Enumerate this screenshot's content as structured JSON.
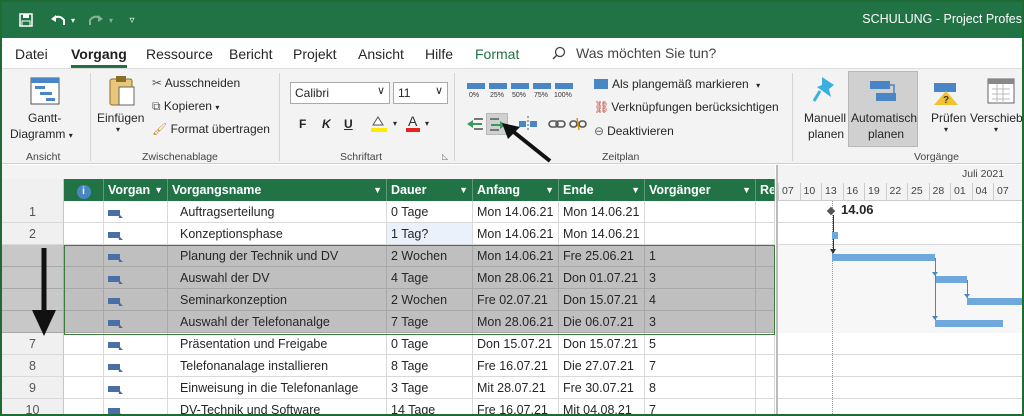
{
  "title_bar": {
    "title": "SCHULUNG  -  Project Profes"
  },
  "tabs": [
    "Datei",
    "Vorgang",
    "Ressource",
    "Bericht",
    "Projekt",
    "Ansicht",
    "Hilfe",
    "Format"
  ],
  "tell_me": "Was möchten Sie tun?",
  "ribbon": {
    "ansicht": {
      "label": "Ansicht",
      "gantt_line1": "Gantt-",
      "gantt_line2": "Diagramm"
    },
    "zwischenablage": {
      "label": "Zwischenablage",
      "paste": "Einfügen",
      "cut": "Ausschneiden",
      "copy": "Kopieren",
      "format_painter": "Format übertragen"
    },
    "schriftart": {
      "label": "Schriftart",
      "font": "Calibri",
      "size": "11",
      "bold": "F",
      "italic": "K",
      "underline": "U"
    },
    "zeitplan": {
      "label": "Zeitplan",
      "pct": [
        "0%",
        "25%",
        "50%",
        "75%",
        "100%"
      ],
      "mark_on_track": "Als plangemäß markieren",
      "respect_links": "Verknüpfungen berücksichtigen",
      "deactivate": "Deaktivieren"
    },
    "vorgaenge": {
      "label": "Vorgänge",
      "manual_1": "Manuell",
      "manual_2": "planen",
      "auto_1": "Automatisch",
      "auto_2": "planen",
      "inspect": "Prüfen",
      "move": "Verschieb"
    }
  },
  "table": {
    "columns": [
      "Vorgan",
      "Vorgangsname",
      "Dauer",
      "Anfang",
      "Ende",
      "Vorgänger",
      "Re"
    ],
    "rows": [
      {
        "num": "1",
        "name": "Auftragserteilung",
        "dauer": "0 Tage",
        "anfang": "Mon 14.06.21",
        "ende": "Mon 14.06.21",
        "vorg": ""
      },
      {
        "num": "2",
        "name": "Konzeptionsphase",
        "dauer": "1 Tag?",
        "anfang": "Mon 14.06.21",
        "ende": "Mon 14.06.21",
        "vorg": ""
      },
      {
        "num": "",
        "name": "Planung der Technik und DV",
        "dauer": "2 Wochen",
        "anfang": "Mon 14.06.21",
        "ende": "Fre 25.06.21",
        "vorg": "1"
      },
      {
        "num": "",
        "name": "Auswahl der DV",
        "dauer": "4 Tage",
        "anfang": "Mon 28.06.21",
        "ende": "Don 01.07.21",
        "vorg": "3"
      },
      {
        "num": "",
        "name": "Seminarkonzeption",
        "dauer": "2 Wochen",
        "anfang": "Fre 02.07.21",
        "ende": "Don 15.07.21",
        "vorg": "4"
      },
      {
        "num": "",
        "name": "Auswahl der Telefonanalge",
        "dauer": "7 Tage",
        "anfang": "Mon 28.06.21",
        "ende": "Die 06.07.21",
        "vorg": "3"
      },
      {
        "num": "7",
        "name": "Präsentation und Freigabe",
        "dauer": "0 Tage",
        "anfang": "Don 15.07.21",
        "ende": "Don 15.07.21",
        "vorg": "5"
      },
      {
        "num": "8",
        "name": "Telefonanalage installieren",
        "dauer": "8 Tage",
        "anfang": "Fre 16.07.21",
        "ende": "Die 27.07.21",
        "vorg": "7"
      },
      {
        "num": "9",
        "name": "Einweisung in die Telefonanlage",
        "dauer": "3 Tage",
        "anfang": "Mit 28.07.21",
        "ende": "Fre 30.07.21",
        "vorg": "8"
      },
      {
        "num": "10",
        "name": "DV-Technik und Software",
        "dauer": "14 Tage",
        "anfang": "Fre 16.07.21",
        "ende": "Mit 04.08.21",
        "vorg": "7"
      }
    ]
  },
  "gantt": {
    "month": "Juli 2021",
    "days": [
      "07",
      "10",
      "13",
      "16",
      "19",
      "22",
      "25",
      "28",
      "01",
      "04",
      "07"
    ],
    "milestone_label": "14.06"
  },
  "colors": {
    "accent": "#217346",
    "bar": "#6fa8dc",
    "selected_row": "#bfbfbf"
  }
}
